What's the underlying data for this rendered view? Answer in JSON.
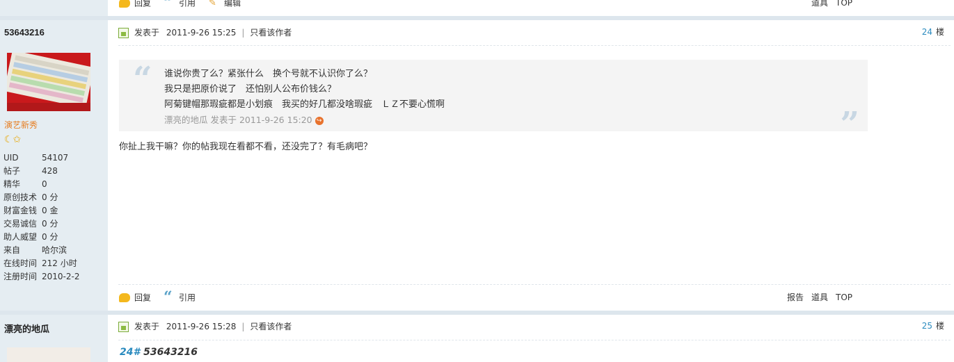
{
  "prev_post": {
    "actions": {
      "reply": "回复",
      "quote": "引用",
      "edit": "编辑"
    },
    "right_links": {
      "tools": "道具",
      "top": "TOP"
    }
  },
  "post": {
    "username": "53643216",
    "usergroup": "演艺新秀",
    "rank_icons": "☾✩",
    "stats": [
      {
        "label": "UID",
        "value": "54107"
      },
      {
        "label": "帖子",
        "value": "428"
      },
      {
        "label": "精华",
        "value": "0"
      },
      {
        "label": "原创技术",
        "value": "0 分"
      },
      {
        "label": "财富金钱",
        "value": "0 金"
      },
      {
        "label": "交易诚信",
        "value": "0 分"
      },
      {
        "label": "助人威望",
        "value": "0 分"
      },
      {
        "label": "来自",
        "value": "哈尔滨"
      },
      {
        "label": "在线时间",
        "value": "212 小时"
      },
      {
        "label": "注册时间",
        "value": "2010-2-2"
      }
    ],
    "meta": {
      "posted_prefix": "发表于",
      "datetime": "2011-9-26 15:25",
      "separator": "|",
      "only_author": "只看该作者"
    },
    "floor": {
      "number": "24",
      "label": "楼"
    },
    "quote": {
      "lines": [
        "谁说你贵了么？紧张什么　换个号就不认识你了么？",
        "我只是把原价说了　还怕别人公布价钱么？",
        "阿菊键帽那瑕疵都是小划痕　我买的好几都没啥瑕疵　ＬＺ不要心慌啊"
      ],
      "attribution": "漂亮的地瓜 发表于 2011-9-26 15:20",
      "goto_icon": "↪"
    },
    "reply_text": "你扯上我干嘛？你的帖我现在看都不看，还没完了？有毛病吧？",
    "actions": {
      "reply": "回复",
      "quote": "引用"
    },
    "right_links": {
      "report": "报告",
      "tools": "道具",
      "top": "TOP"
    }
  },
  "next_post": {
    "username": "漂亮的地瓜",
    "meta": {
      "posted_prefix": "发表于",
      "datetime": "2011-9-26 15:28",
      "separator": "|",
      "only_author": "只看该作者"
    },
    "floor": {
      "number": "25",
      "label": "楼"
    },
    "title_num": "24#",
    "title_name": "53643216"
  },
  "colors": {
    "sidebar_bg": "#e5edf2",
    "link_blue": "#2b8bbf",
    "usergroup_orange": "#e67e22",
    "quote_bg": "#f4f4f4"
  }
}
